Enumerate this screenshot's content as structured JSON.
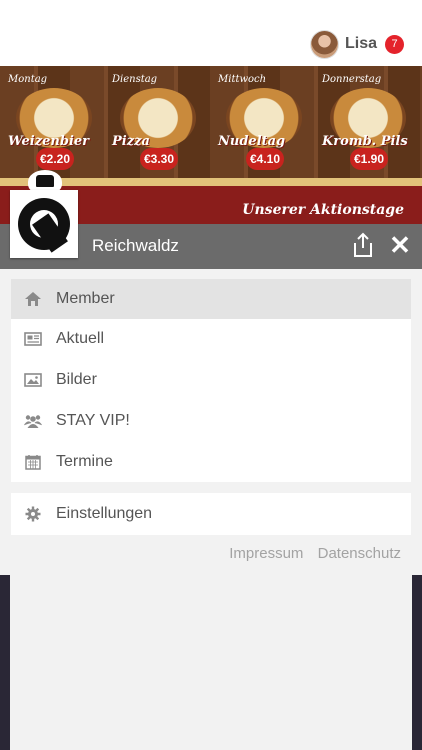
{
  "user": {
    "name": "Lisa",
    "notifications": "7"
  },
  "banner": {
    "days": [
      {
        "day": "Montag",
        "dish": "Weizenbier",
        "price": "€2.20"
      },
      {
        "day": "Dienstag",
        "dish": "Pizza",
        "price": "€3.30"
      },
      {
        "day": "Mittwoch",
        "dish": "Nudeltag",
        "price": "€4.10"
      },
      {
        "day": "Donnerstag",
        "dish": "Kromb. Pils",
        "price": "€1.90"
      }
    ],
    "slogan": "Unserer Aktionstage"
  },
  "app": {
    "title": "Reichwaldz"
  },
  "menu": {
    "items": [
      {
        "label": "Member",
        "icon": "home-icon"
      },
      {
        "label": "Aktuell",
        "icon": "newspaper-icon"
      },
      {
        "label": "Bilder",
        "icon": "image-icon"
      },
      {
        "label": "STAY VIP!",
        "icon": "users-icon"
      },
      {
        "label": "Termine",
        "icon": "calendar-icon"
      }
    ],
    "settings": {
      "label": "Einstellungen",
      "icon": "gear-icon"
    }
  },
  "footer": {
    "impressum": "Impressum",
    "datenschutz": "Datenschutz"
  },
  "colors": {
    "badge": "#e4232b",
    "titlebar": "#6b6b6b",
    "active_row": "#e3e3e3"
  }
}
